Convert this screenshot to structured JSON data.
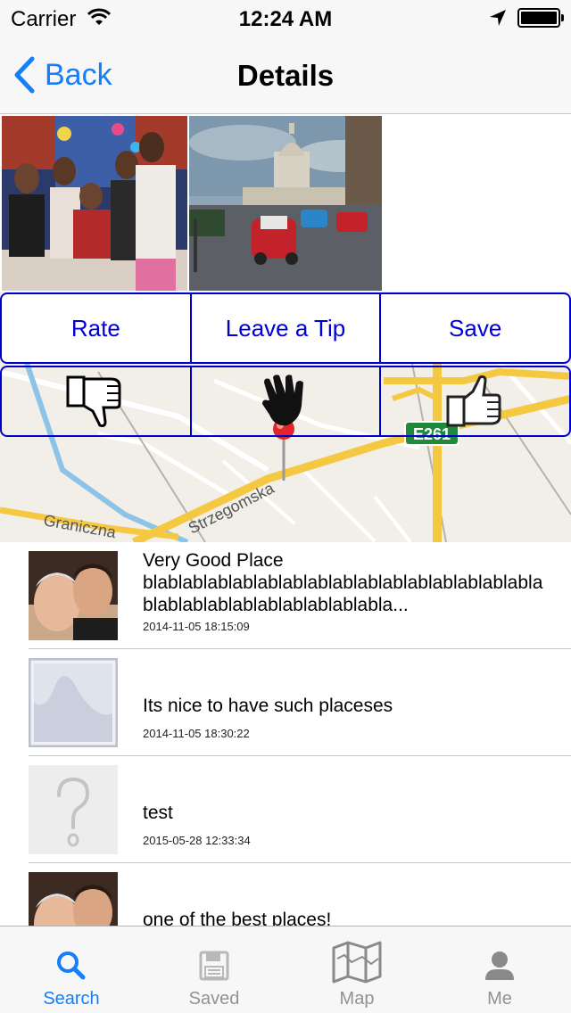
{
  "status": {
    "carrier": "Carrier",
    "time": "12:24 AM"
  },
  "nav": {
    "back_label": "Back",
    "title": "Details"
  },
  "actions": {
    "rate": "Rate",
    "tip": "Leave a Tip",
    "save": "Save"
  },
  "map": {
    "street1": "Graniczna",
    "street2": "Strzegomska",
    "road_sign": "E261"
  },
  "reviews": [
    {
      "title": "Very Good Place",
      "comment": "blablablablablablablablablablablablablablablablablablablablablablablablablabla...",
      "date": "2014-11-05 18:15:09",
      "avatar": "two-men-photo"
    },
    {
      "title": "Its nice to have such placeses",
      "date": "2014-11-05 18:30:22",
      "avatar": "image-placeholder-icon"
    },
    {
      "title": "test",
      "date": "2015-05-28 12:33:34",
      "avatar": "question-mark-icon"
    },
    {
      "title": "one of the best places!",
      "date": "",
      "avatar": "two-men-photo"
    }
  ],
  "tabs": [
    {
      "label": "Search",
      "icon": "search-icon",
      "active": true
    },
    {
      "label": "Saved",
      "icon": "floppy-disk-icon",
      "active": false
    },
    {
      "label": "Map",
      "icon": "map-icon",
      "active": false
    },
    {
      "label": "Me",
      "icon": "person-icon",
      "active": false
    }
  ],
  "colors": {
    "accent": "#157efb",
    "button_border": "#0000cc",
    "tab_inactive": "#929292"
  }
}
